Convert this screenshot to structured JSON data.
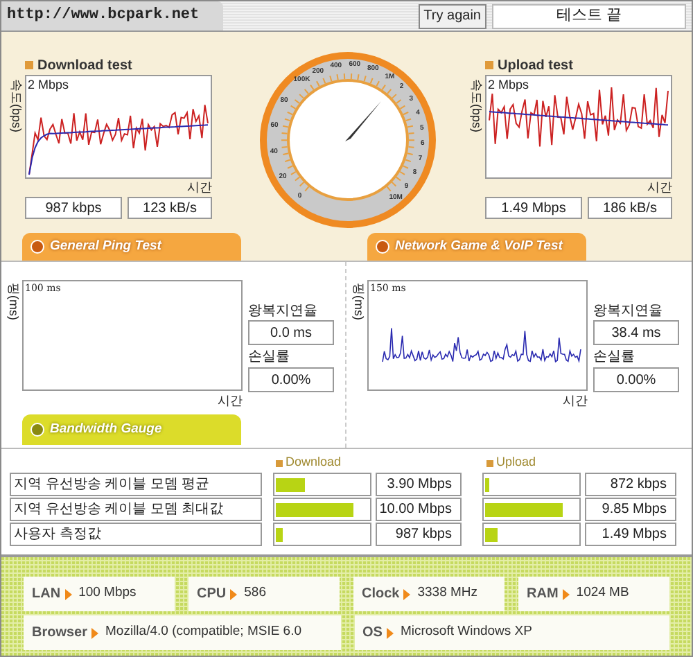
{
  "header": {
    "url": "http://www.bcpark.net",
    "try_again": "Try again",
    "status": "테스트 끝"
  },
  "download": {
    "title": "Download test",
    "y_label": "속도(bps)",
    "scale": "2 Mbps",
    "x_label": "시간",
    "values": [
      "987 kbps",
      "123 kB/s"
    ]
  },
  "gauge": {
    "ticks": [
      "0",
      "20",
      "40",
      "60",
      "80",
      "100K",
      "200",
      "400",
      "600",
      "800",
      "1M",
      "2",
      "3",
      "4",
      "5",
      "6",
      "7",
      "8",
      "9",
      "10M"
    ]
  },
  "upload": {
    "title": "Upload test",
    "y_label": "속도(bps)",
    "scale": "2 Mbps",
    "x_label": "시간",
    "values": [
      "1.49 Mbps",
      "186 kB/s"
    ]
  },
  "sections": [
    {
      "title": "General Ping Test"
    },
    {
      "title": "Network Game & VoIP Test"
    }
  ],
  "ping_panels": [
    {
      "y_label": "핑(ms)",
      "scale": "100 ms",
      "x_label": "시간",
      "latency_label": "왕복지연율",
      "latency": "0.0 ms",
      "loss_label": "손실률",
      "loss": "0.00%"
    },
    {
      "y_label": "핑(ms)",
      "scale": "150 ms",
      "x_label": "시간",
      "latency_label": "왕복지연율",
      "latency": "38.4 ms",
      "loss_label": "손실률",
      "loss": "0.00%"
    }
  ],
  "bandwidth": {
    "title": "Bandwidth Gauge",
    "columns": [
      "Download",
      "Upload"
    ],
    "rows": [
      {
        "label": "지역 유선방송 케이블 모뎀 평균",
        "download": {
          "level": 0.31,
          "value": "3.90 Mbps"
        },
        "upload": {
          "level": 0.05,
          "value": "872 kbps"
        }
      },
      {
        "label": "지역 유선방송 케이블 모뎀 최대값",
        "download": {
          "level": 0.84,
          "value": "10.00 Mbps"
        },
        "upload": {
          "level": 0.84,
          "value": "9.85 Mbps"
        }
      },
      {
        "label": "사용자 측정값",
        "download": {
          "level": 0.07,
          "value": "987 kbps"
        },
        "upload": {
          "level": 0.13,
          "value": "1.49 Mbps"
        }
      }
    ]
  },
  "system": [
    [
      {
        "label": "LAN",
        "value": "100 Mbps"
      },
      {
        "label": "CPU",
        "value": "586"
      },
      {
        "label": "Clock",
        "value": "3338 MHz"
      },
      {
        "label": "RAM",
        "value": "1024 MB"
      }
    ],
    [
      {
        "label": "Browser",
        "value": "Mozilla/4.0 (compatible; MSIE 6.0"
      },
      {
        "label": "OS",
        "value": "Microsoft Windows XP"
      }
    ]
  ]
}
